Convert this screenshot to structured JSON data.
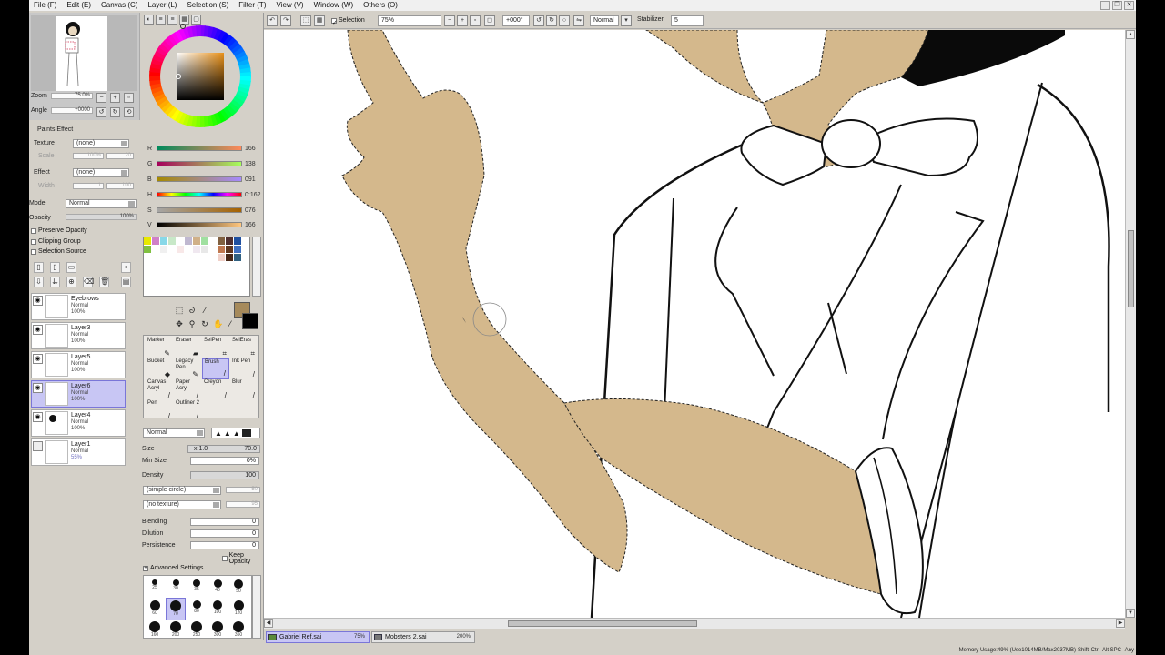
{
  "menu": [
    "File (F)",
    "Edit (E)",
    "Canvas (C)",
    "Layer (L)",
    "Selection (S)",
    "Filter (T)",
    "View (V)",
    "Window (W)",
    "Others (O)"
  ],
  "navigator": {
    "zoom_label": "Zoom",
    "zoom_value": "75.0%",
    "angle_label": "Angle",
    "angle_value": "+0000"
  },
  "paint_effect": {
    "title": "Paints Effect",
    "texture_label": "Texture",
    "texture_value": "(none)",
    "texture_scale": "100%",
    "texture_level": "20",
    "texture_scale_label": "Scale",
    "effect_label": "Effect",
    "effect_value": "(none)",
    "effect_width_label": "Width",
    "effect_width": "1",
    "effect_amount": "100",
    "mode_label": "Mode",
    "mode_value": "Normal",
    "opacity_label": "Opacity",
    "opacity_value": "100%",
    "checks": [
      "Preserve Opacity",
      "Clipping Group",
      "Selection Source"
    ]
  },
  "layers": [
    {
      "name": "Eyebrows",
      "mode": "Normal",
      "opacity": "100%",
      "visible": true,
      "selected": false
    },
    {
      "name": "Layer3",
      "mode": "Normal",
      "opacity": "100%",
      "visible": true,
      "selected": false
    },
    {
      "name": "Layer5",
      "mode": "Normal",
      "opacity": "100%",
      "visible": true,
      "selected": false
    },
    {
      "name": "Layer6",
      "mode": "Normal",
      "opacity": "100%",
      "visible": true,
      "selected": true
    },
    {
      "name": "Layer4",
      "mode": "Normal",
      "opacity": "100%",
      "visible": true,
      "selected": false
    },
    {
      "name": "Layer1",
      "mode": "Normal",
      "opacity": "55%",
      "visible": false,
      "selected": false
    }
  ],
  "color": {
    "rgb": [
      {
        "label": "R",
        "value": "166"
      },
      {
        "label": "G",
        "value": "138"
      },
      {
        "label": "B",
        "value": "091"
      }
    ],
    "hsv": [
      {
        "label": "H",
        "value": "0:162"
      },
      {
        "label": "S",
        "value": "076"
      },
      {
        "label": "V",
        "value": "166"
      }
    ],
    "foreground": "#a68a5b",
    "background": "#000000",
    "skin": "#d4b88c"
  },
  "swatches": [
    "#e8e800",
    "#d080c8",
    "#88d8e8",
    "#c8e8c8",
    "#ffffff",
    "#c0b8d0",
    "#d0b088",
    "#a0e0a0",
    "#ffffff",
    "#806040",
    "#503030",
    "#2050a0",
    "#80c040",
    "#ffffff",
    "#f0f0f0",
    "#ffffff",
    "#f8e8e8",
    "#ffffff",
    "#f0e8f0",
    "#e8e8e8",
    "#ffffff",
    "#c07850",
    "#603820",
    "#4070c0",
    "#ffffff",
    "#ffffff",
    "#ffffff",
    "#ffffff",
    "#ffffff",
    "#ffffff",
    "#ffffff",
    "#ffffff",
    "#ffffff",
    "#f0d0c8",
    "#482818",
    "#306080",
    "#ffffff",
    "#ffffff",
    "#ffffff",
    "#ffffff",
    "#ffffff",
    "#ffffff",
    "#ffffff",
    "#ffffff",
    "#ffffff",
    "#ffffff",
    "#ffffff",
    "#ffffff"
  ],
  "brush_tools": [
    {
      "label": "Marker",
      "icon": "✎"
    },
    {
      "label": "Eraser",
      "icon": "▰"
    },
    {
      "label": "SelPen",
      "icon": "⌗"
    },
    {
      "label": "SelEras",
      "icon": "⌗"
    },
    {
      "label": "Bucket",
      "icon": "◆"
    },
    {
      "label": "Legacy Pen",
      "icon": "✎"
    },
    {
      "label": "Brush",
      "icon": "/"
    },
    {
      "label": "Ink Pen",
      "icon": "/"
    },
    {
      "label": "Canvas Acryl",
      "icon": "/"
    },
    {
      "label": "Paper Acryl",
      "icon": "/"
    },
    {
      "label": "Creyon",
      "icon": "/"
    },
    {
      "label": "Blur",
      "icon": "/"
    },
    {
      "label": "Pen",
      "icon": "/"
    },
    {
      "label": "Outliner 2",
      "icon": "/"
    }
  ],
  "brush": {
    "mode": "Normal",
    "size_label": "Size",
    "size_mult": "x 1.0",
    "size_value": "70.0",
    "min_size_label": "Min Size",
    "min_size_value": "0%",
    "density_label": "Density",
    "density_value": "100",
    "shape": "(simple circle)",
    "shape_value": "50",
    "texture": "(no texture)",
    "texture_value": "95",
    "blending_label": "Blending",
    "blending_value": "0",
    "dilution_label": "Dilution",
    "dilution_value": "0",
    "persistence_label": "Persistence",
    "persistence_value": "0",
    "keep_opacity": "Keep Opacity",
    "advanced": "Advanced Settings"
  },
  "dot_sizes": [
    "25",
    "30",
    "35",
    "40",
    "50",
    "60",
    "70",
    "80",
    "100",
    "120",
    "160",
    "200",
    "250",
    "300",
    "350"
  ],
  "toolbar": {
    "selection_label": "Selection",
    "zoom": "75%",
    "angle": "+000°",
    "blend_mode": "Normal",
    "stabilizer_label": "Stabilizer",
    "stabilizer_value": "5"
  },
  "tabs": [
    {
      "name": "Gabriel Ref.sai",
      "zoom": "75%",
      "active": true
    },
    {
      "name": "Mobsters 2.sai",
      "zoom": "200%",
      "active": false
    }
  ],
  "status": {
    "memory": "Memory Usage:49% (Use1014MB/Max2037MB)",
    "keys": [
      "Shift",
      "Ctrl",
      "Alt",
      "SPC",
      "Any"
    ]
  }
}
